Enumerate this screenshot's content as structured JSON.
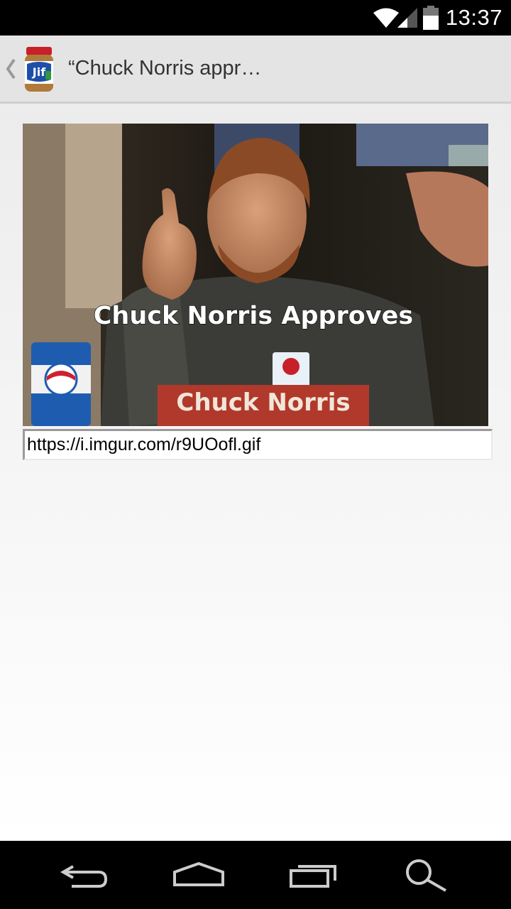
{
  "status_bar": {
    "time": "13:37",
    "icons": [
      "wifi-icon",
      "signal-icon",
      "battery-icon"
    ]
  },
  "action_bar": {
    "title": "“Chuck Norris appr…",
    "app_icon": "jif-jar-icon",
    "up_icon": "chevron-left-icon"
  },
  "content": {
    "image": {
      "caption": "Chuck Norris Approves",
      "nameplate": "Chuck Norris"
    },
    "url_field": {
      "value": "https://i.imgur.com/r9UOofl.gif"
    }
  },
  "nav_bar": {
    "buttons": [
      "back-icon",
      "home-icon",
      "recent-apps-icon",
      "search-icon"
    ]
  },
  "colors": {
    "status_bar": "#000000",
    "action_bar": "#e4e4e4",
    "nav_bar": "#000000"
  }
}
